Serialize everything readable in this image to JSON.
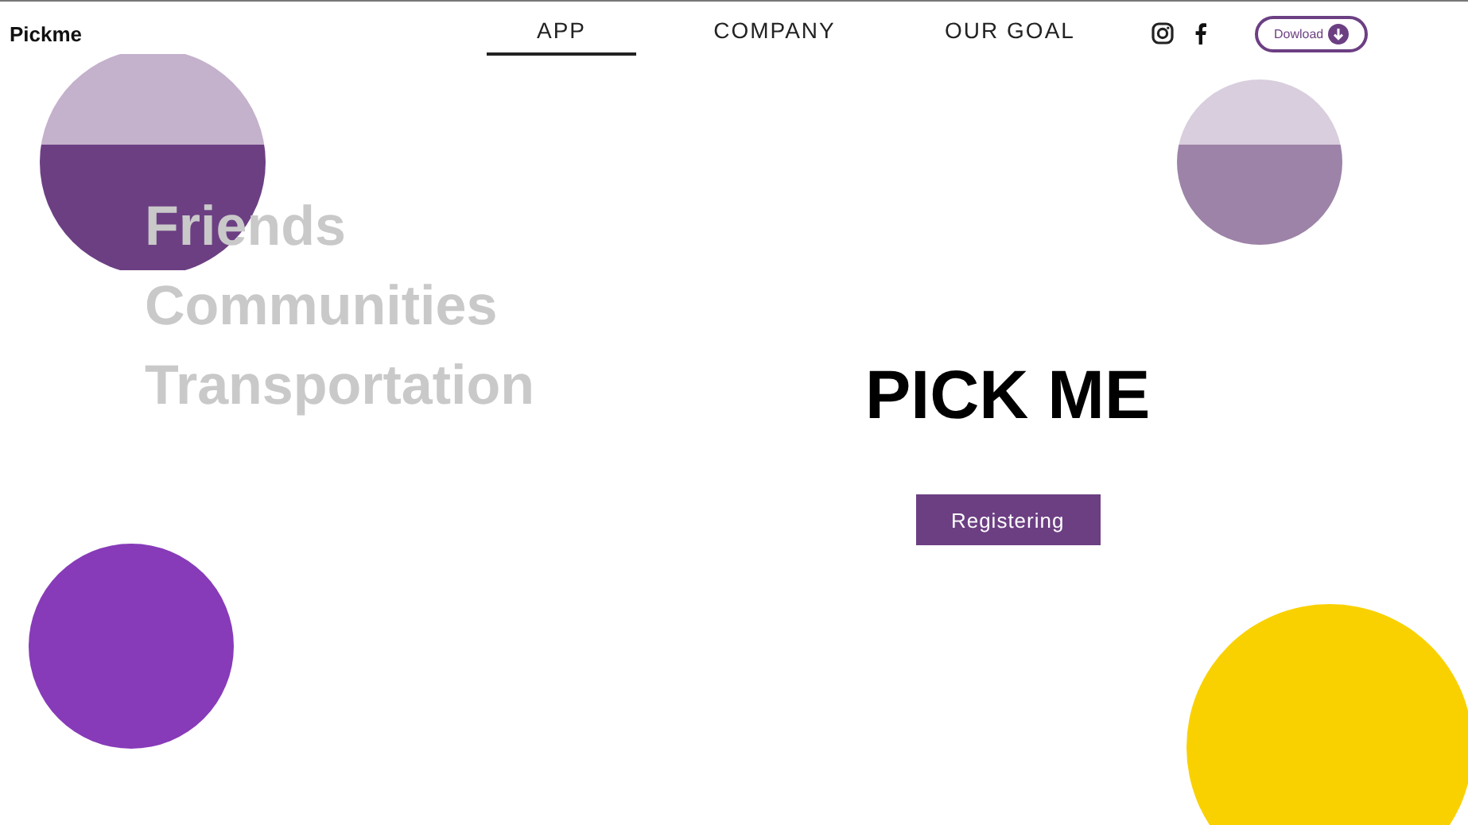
{
  "brand": "Pickme",
  "nav": [
    {
      "label": "APP",
      "selected": true
    },
    {
      "label": "COMPANY",
      "selected": false
    },
    {
      "label": "OUR GOAL",
      "selected": false
    }
  ],
  "download_button": "Dowload",
  "taglines": [
    "Friends",
    "Communities",
    "Transportation"
  ],
  "hero": {
    "title": "PICK ME",
    "button": "Registering"
  }
}
